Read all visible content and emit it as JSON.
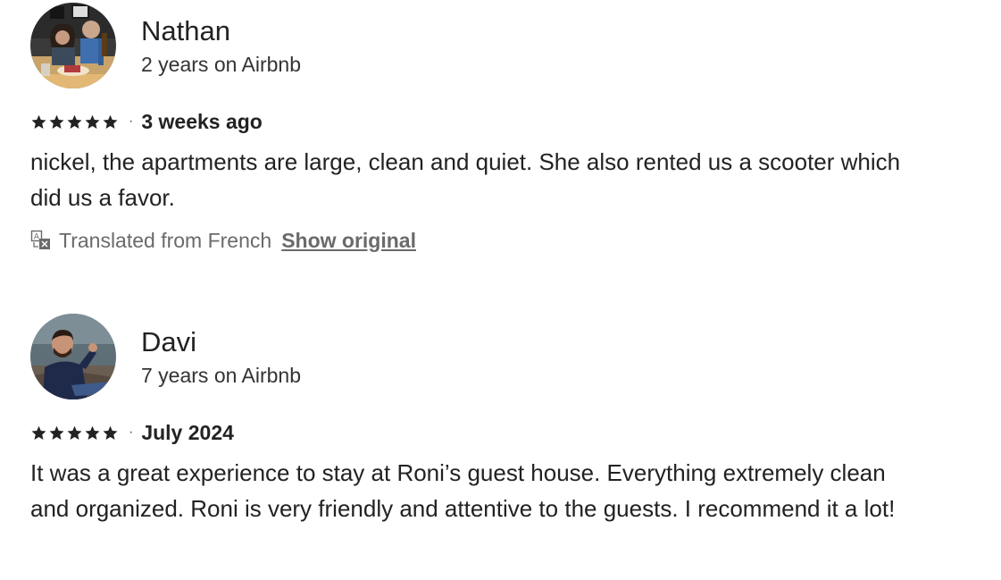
{
  "reviews": [
    {
      "reviewer_name": "Nathan",
      "reviewer_tenure": "2 years on Airbnb",
      "rating_stars": 5,
      "separator": "·",
      "date": "3 weeks ago",
      "text": "nickel, the apartments are large, clean and quiet. She also rented us a scooter which did us a favor.",
      "translation_note": "Translated from French",
      "show_original_label": "Show original"
    },
    {
      "reviewer_name": "Davi",
      "reviewer_tenure": "7 years on Airbnb",
      "rating_stars": 5,
      "separator": "·",
      "date": "July 2024",
      "text": "It was a great experience to stay at Roni’s guest house. Everything extremely clean and organized. Roni is very friendly and attentive to the guests. I recommend it a lot!"
    }
  ],
  "icons": {
    "star": "star-icon",
    "translate": "translate-icon",
    "avatar": "avatar-photo"
  },
  "colors": {
    "text_primary": "#222222",
    "text_secondary": "#6a6a6a",
    "star": "#222222"
  }
}
